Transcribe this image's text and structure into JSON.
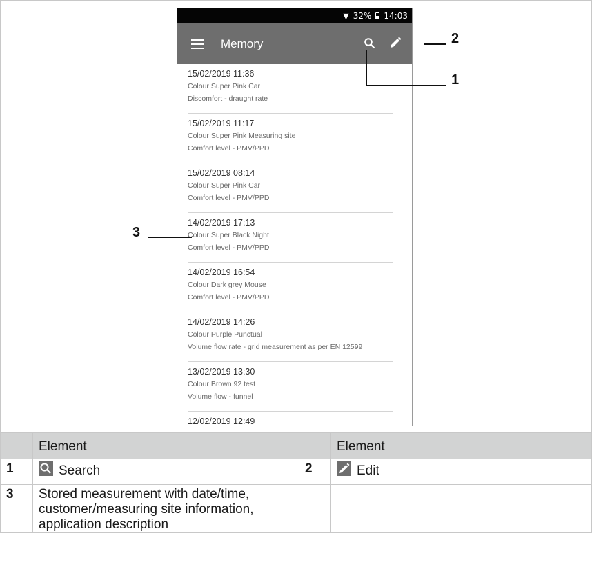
{
  "status": {
    "battery_pct": "32%",
    "time": "14:03"
  },
  "appbar": {
    "title": "Memory"
  },
  "items": [
    {
      "datetime": "15/02/2019 11:36",
      "line2": "Colour Super Pink Car",
      "line3": "Discomfort - draught rate"
    },
    {
      "datetime": "15/02/2019 11:17",
      "line2": "Colour Super Pink Measuring site",
      "line3": "Comfort level - PMV/PPD"
    },
    {
      "datetime": "15/02/2019 08:14",
      "line2": "Colour Super Pink Car",
      "line3": "Comfort level - PMV/PPD"
    },
    {
      "datetime": "14/02/2019 17:13",
      "line2": "Colour Super Black Night",
      "line3": "Comfort level - PMV/PPD"
    },
    {
      "datetime": "14/02/2019 16:54",
      "line2": "Colour Dark grey Mouse",
      "line3": "Comfort level - PMV/PPD"
    },
    {
      "datetime": "14/02/2019 14:26",
      "line2": "Colour Purple Punctual",
      "line3": "Volume flow rate - grid measurement as per EN 12599"
    },
    {
      "datetime": "13/02/2019 13:30",
      "line2": "Colour Brown 92 test",
      "line3": "Volume flow - funnel"
    },
    {
      "datetime": "12/02/2019 12:49",
      "line2": "",
      "line3": ""
    }
  ],
  "callouts": {
    "c1": "1",
    "c2": "2",
    "c3": "3"
  },
  "table": {
    "header_left": "Element",
    "header_right": "Element",
    "r1_num": "1",
    "r1_text": "Search",
    "r1_icon": "search-icon",
    "r1_right_num": "2",
    "r1_right_text": "Edit",
    "r1_right_icon": "edit-icon",
    "r2_num": "3",
    "r2_text": "Stored measurement with date/time, customer/measuring site information, application description"
  }
}
